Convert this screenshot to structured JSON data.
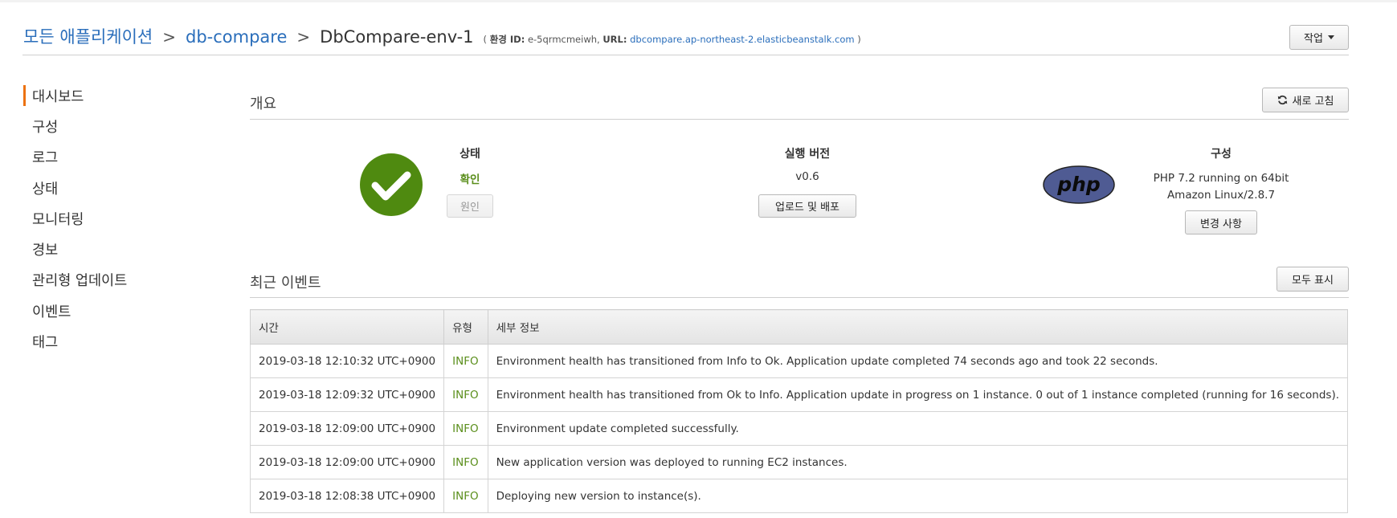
{
  "breadcrumb": {
    "all_apps": "모든 애플리케이션",
    "app": "db-compare",
    "env": "DbCompare-env-1",
    "sep": ">",
    "meta_open": "(",
    "env_id_label": "환경 ID:",
    "env_id": "e-5qrmcmeiwh,",
    "url_label": "URL:",
    "url": "dbcompare.ap-northeast-2.elasticbeanstalk.com",
    "meta_close": ")"
  },
  "actions_button": "작업",
  "sidebar": {
    "items": [
      {
        "label": "대시보드"
      },
      {
        "label": "구성"
      },
      {
        "label": "로그"
      },
      {
        "label": "상태"
      },
      {
        "label": "모니터링"
      },
      {
        "label": "경보"
      },
      {
        "label": "관리형 업데이트"
      },
      {
        "label": "이벤트"
      },
      {
        "label": "태그"
      }
    ]
  },
  "overview": {
    "title": "개요",
    "refresh_label": "새로 고침",
    "health": {
      "heading": "상태",
      "value": "확인",
      "button": "원인"
    },
    "version": {
      "heading": "실행 버전",
      "value": "v0.6",
      "button": "업로드 및 배포"
    },
    "config": {
      "heading": "구성",
      "logo": "php",
      "value": "PHP 7.2 running on 64bit Amazon Linux/2.8.7",
      "button": "변경 사항"
    }
  },
  "events": {
    "title": "최근 이벤트",
    "show_all": "모두 표시",
    "columns": [
      "시간",
      "유형",
      "세부 정보"
    ],
    "rows": [
      {
        "time": "2019-03-18 12:10:32 UTC+0900",
        "type": "INFO",
        "detail": "Environment health has transitioned from Info to Ok. Application update completed 74 seconds ago and took 22 seconds."
      },
      {
        "time": "2019-03-18 12:09:32 UTC+0900",
        "type": "INFO",
        "detail": "Environment health has transitioned from Ok to Info. Application update in progress on 1 instance. 0 out of 1 instance completed (running for 16 seconds)."
      },
      {
        "time": "2019-03-18 12:09:00 UTC+0900",
        "type": "INFO",
        "detail": "Environment update completed successfully."
      },
      {
        "time": "2019-03-18 12:09:00 UTC+0900",
        "type": "INFO",
        "detail": "New application version was deployed to running EC2 instances."
      },
      {
        "time": "2019-03-18 12:08:38 UTC+0900",
        "type": "INFO",
        "detail": "Deploying new version to instance(s)."
      }
    ]
  },
  "colors": {
    "link": "#2a6ebb",
    "ok_green": "#5a8e1b",
    "active_accent": "#ec7211",
    "php_badge": "#4f5b93"
  },
  "icons": {
    "health": "check-circle-icon",
    "refresh": "refresh-icon",
    "dropdown": "caret-down-icon"
  }
}
